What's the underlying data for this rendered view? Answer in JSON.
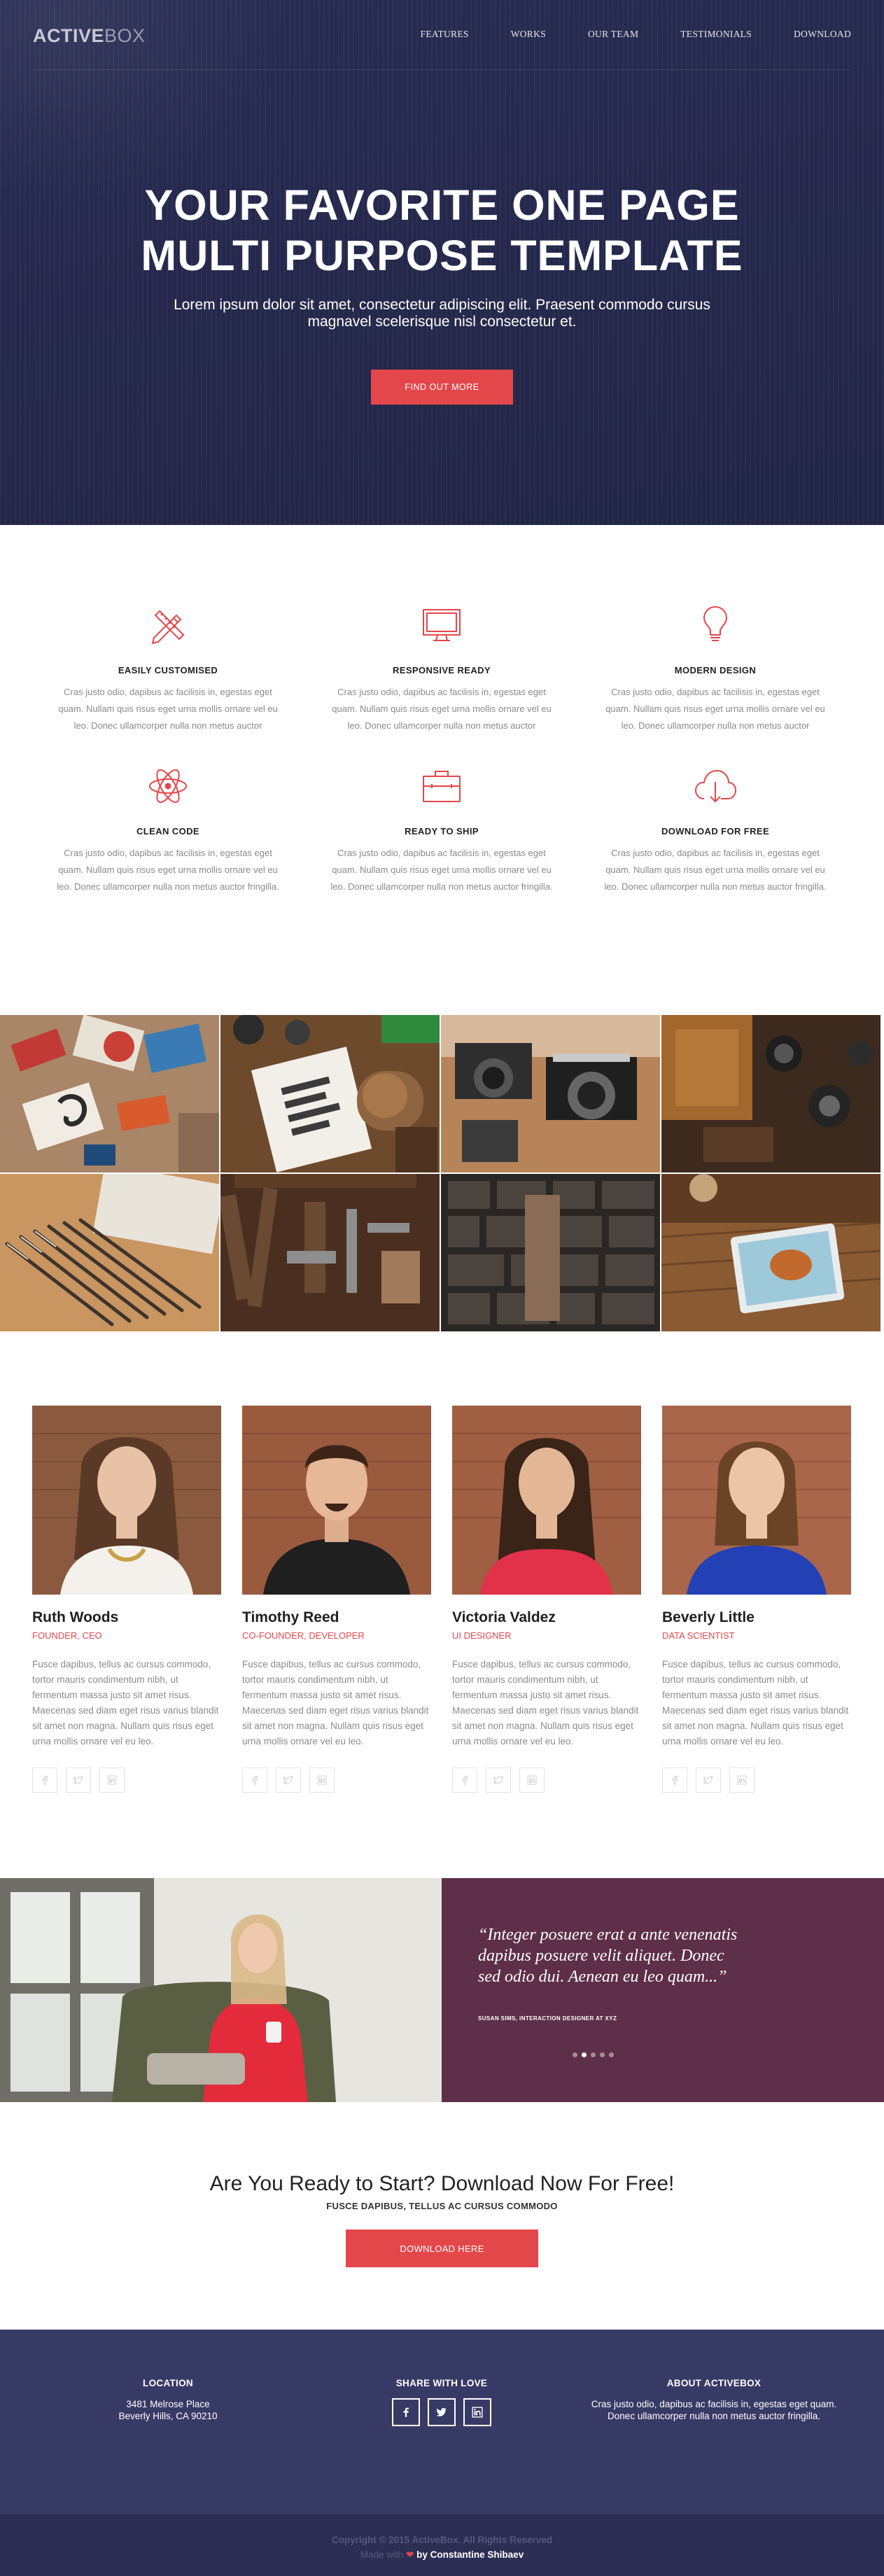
{
  "nav": {
    "logo_bold": "ACTIVE",
    "logo_light": "BOX",
    "items": [
      {
        "label": "FEATURES"
      },
      {
        "label": "WORKS"
      },
      {
        "label": "OUR TEAM"
      },
      {
        "label": "TESTIMONIALS"
      },
      {
        "label": "DOWNLOAD"
      }
    ]
  },
  "hero": {
    "title_line1": "YOUR FAVORITE ONE PAGE",
    "title_line2": "MULTI PURPOSE TEMPLATE",
    "subtitle": "Lorem ipsum dolor sit amet, consectetur adipiscing elit. Praesent commodo cursus magnavel scelerisque nisl consectetur et.",
    "button": "FIND OUT MORE"
  },
  "features": [
    {
      "icon": "pencil-ruler-icon",
      "title": "EASILY CUSTOMISED",
      "text": "Cras justo odio, dapibus ac facilisis in, egestas eget quam. Nullam quis risus eget urna mollis ornare vel eu leo. Donec ullamcorper nulla non metus auctor"
    },
    {
      "icon": "monitor-icon",
      "title": "RESPONSIVE READY",
      "text": "Cras justo odio, dapibus ac facilisis in, egestas eget quam. Nullam quis risus eget urna mollis ornare vel eu leo. Donec ullamcorper nulla non metus auctor"
    },
    {
      "icon": "lightbulb-icon",
      "title": "MODERN DESIGN",
      "text": "Cras justo odio, dapibus ac facilisis in, egestas eget quam. Nullam quis risus eget urna mollis ornare vel eu leo. Donec ullamcorper nulla non metus auctor"
    },
    {
      "icon": "atom-icon",
      "title": "CLEAN CODE",
      "text": "Cras justo odio, dapibus ac facilisis in, egestas eget quam. Nullam quis risus eget urna mollis ornare vel eu leo. Donec ullamcorper nulla non metus auctor fringilla."
    },
    {
      "icon": "briefcase-icon",
      "title": "READY TO SHIP",
      "text": "Cras justo odio, dapibus ac facilisis in, egestas eget quam. Nullam quis risus eget urna mollis ornare vel eu leo. Donec ullamcorper nulla non metus auctor fringilla."
    },
    {
      "icon": "cloud-download-icon",
      "title": "DOWNLOAD FOR FREE",
      "text": "Cras justo odio, dapibus ac facilisis in, egestas eget quam. Nullam quis risus eget urna mollis ornare vel eu leo. Donec ullamcorper nulla non metus auctor fringilla."
    }
  ],
  "gallery": {
    "tiles": [
      {
        "name": "stationery-photo"
      },
      {
        "name": "notebook-photo"
      },
      {
        "name": "camera-photo"
      },
      {
        "name": "desk-tools-photo"
      },
      {
        "name": "pencils-photo"
      },
      {
        "name": "hand-tools-photo"
      },
      {
        "name": "letterpress-photo"
      },
      {
        "name": "food-plate-photo"
      }
    ]
  },
  "team": {
    "members": [
      {
        "name": "Ruth Woods",
        "role": "FOUNDER, CEO",
        "bio": "Fusce dapibus, tellus ac cursus commodo, tortor mauris condimentum nibh, ut fermentum massa justo sit amet risus. Maecenas sed diam eget risus varius blandit sit amet non magna. Nullam quis risus eget urna mollis ornare vel eu leo."
      },
      {
        "name": "Timothy Reed",
        "role": "CO-FOUNDER, DEVELOPER",
        "bio": "Fusce dapibus, tellus ac cursus commodo, tortor mauris condimentum nibh, ut fermentum massa justo sit amet risus. Maecenas sed diam eget risus varius blandit sit amet non magna. Nullam quis risus eget urna mollis ornare vel eu leo."
      },
      {
        "name": "Victoria Valdez",
        "role": "UI DESIGNER",
        "bio": "Fusce dapibus, tellus ac cursus commodo, tortor mauris condimentum nibh, ut fermentum massa justo sit amet risus. Maecenas sed diam eget risus varius blandit sit amet non magna. Nullam quis risus eget urna mollis ornare vel eu leo."
      },
      {
        "name": "Beverly Little",
        "role": "DATA SCIENTIST",
        "bio": "Fusce dapibus, tellus ac cursus commodo, tortor mauris condimentum nibh, ut fermentum massa justo sit amet risus. Maecenas sed diam eget risus varius blandit sit amet non magna. Nullam quis risus eget urna mollis ornare vel eu leo."
      }
    ],
    "social_icons": [
      "facebook-icon",
      "twitter-icon",
      "linkedin-icon"
    ]
  },
  "testimonial": {
    "quote": "“Integer posuere erat a ante venenatis dapibus posuere velit aliquet. Donec sed odio dui. Aenean eu leo quam...”",
    "author": "SUSAN SIMS, INTERACTION DESIGNER AT XYZ",
    "active_dot": 2,
    "dot_count": 5
  },
  "cta": {
    "title": "Are You Ready to Start? Download Now For Free!",
    "subtitle": "FUSCE DAPIBUS, TELLUS AC CURSUS COMMODO",
    "button": "DOWNLOAD HERE"
  },
  "footer": {
    "location": {
      "title": "LOCATION",
      "line1": "3481 Melrose Place",
      "line2": "Beverly Hills, CA 90210"
    },
    "share": {
      "title": "SHARE WITH LOVE",
      "icons": [
        "facebook-icon",
        "twitter-icon",
        "linkedin-icon"
      ]
    },
    "about": {
      "title": "ABOUT ACTIVEBOX",
      "line1": "Cras justo odio, dapibus ac facilisis in, egestas eget quam.",
      "line2": "Donec ullamcorper nulla non metus auctor fringilla."
    },
    "copyright": "Copyright © 2015 ActiveBox. All Rights Reserved",
    "made_with": "Made with",
    "author": "by Constantine Shibaev"
  },
  "colors": {
    "accent": "#e4474a",
    "hero_bg": "#282c52",
    "testimonial_bg": "#5e2f48",
    "footer_bg": "#383a66",
    "subfooter_bg": "#2c2e54"
  }
}
